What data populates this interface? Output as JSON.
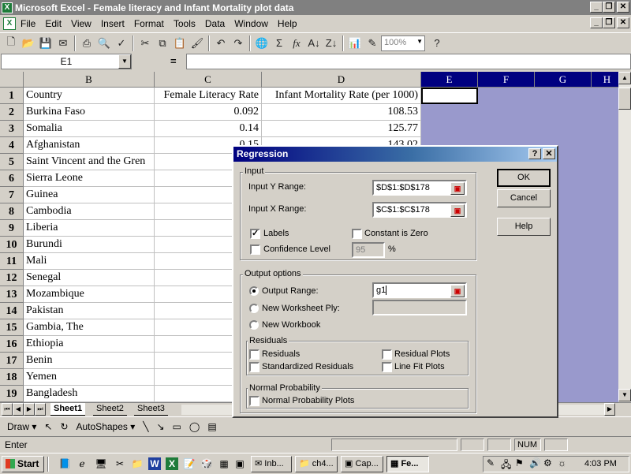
{
  "app": {
    "title": "Microsoft Excel - Female literacy and Infant Mortality plot data",
    "icon_label": "X"
  },
  "menu": [
    "File",
    "Edit",
    "View",
    "Insert",
    "Format",
    "Tools",
    "Data",
    "Window",
    "Help"
  ],
  "toolbar": {
    "zoom": "100%"
  },
  "formula_bar": {
    "name_box": "E1",
    "equals": "=",
    "formula": ""
  },
  "grid": {
    "columns": [
      "B",
      "C",
      "D",
      "E",
      "F",
      "G",
      "H"
    ],
    "selected_column": "E",
    "headers": [
      "Country",
      "Female Literacy Rate",
      "Infant Mortality Rate (per 1000)"
    ],
    "rows": [
      {
        "num": "1"
      },
      {
        "num": "2",
        "country": "Burkina Faso",
        "literacy": "0.092",
        "mortality": "108.53"
      },
      {
        "num": "3",
        "country": "Somalia",
        "literacy": "0.14",
        "mortality": "125.77"
      },
      {
        "num": "4",
        "country": "Afghanistan",
        "literacy": "0.15",
        "mortality": "143.02"
      },
      {
        "num": "5",
        "country": "Saint Vincent and the Gren",
        "literacy": "",
        "mortality": ""
      },
      {
        "num": "6",
        "country": "Sierra Leone"
      },
      {
        "num": "7",
        "country": "Guinea"
      },
      {
        "num": "8",
        "country": "Cambodia"
      },
      {
        "num": "9",
        "country": "Liberia"
      },
      {
        "num": "10",
        "country": "Burundi"
      },
      {
        "num": "11",
        "country": "Mali"
      },
      {
        "num": "12",
        "country": "Senegal"
      },
      {
        "num": "13",
        "country": "Mozambique"
      },
      {
        "num": "14",
        "country": "Pakistan"
      },
      {
        "num": "15",
        "country": "Gambia, The"
      },
      {
        "num": "16",
        "country": "Ethiopia"
      },
      {
        "num": "17",
        "country": "Benin"
      },
      {
        "num": "18",
        "country": "Yemen"
      },
      {
        "num": "19",
        "country": "Bangladesh"
      }
    ]
  },
  "sheets": [
    "Sheet1",
    "Sheet2",
    "Sheet3"
  ],
  "active_sheet": "Sheet1",
  "drawing": {
    "draw": "Draw",
    "autoshapes": "AutoShapes"
  },
  "status": {
    "mode": "Enter",
    "num": "NUM"
  },
  "taskbar": {
    "start": "Start",
    "tasks": [
      "Inb...",
      "ch4...",
      "Cap...",
      "Fe..."
    ],
    "active_task": "Fe...",
    "clock": "4:03 PM"
  },
  "dialog": {
    "title": "Regression",
    "help_glyph": "?",
    "close_glyph": "✕",
    "input_group": "Input",
    "y_range_label": "Input Y Range:",
    "y_range_value": "$D$1:$D$178",
    "x_range_label": "Input X Range:",
    "x_range_value": "$C$1:$C$178",
    "labels_label": "Labels",
    "labels_checked": true,
    "constant_zero_label": "Constant is Zero",
    "constant_zero_checked": false,
    "confidence_label": "Confidence Level",
    "confidence_checked": false,
    "confidence_value": "95",
    "confidence_unit": "%",
    "output_group": "Output options",
    "output_range_label": "Output Range:",
    "output_range_value": "g1",
    "output_range_selected": true,
    "new_ply_label": "New Worksheet Ply:",
    "new_workbook_label": "New Workbook",
    "residuals_group": "Residuals",
    "residuals_label": "Residuals",
    "std_residuals_label": "Standardized Residuals",
    "residual_plots_label": "Residual Plots",
    "line_fit_label": "Line Fit Plots",
    "normal_group": "Normal Probability",
    "normal_plots_label": "Normal Probability Plots",
    "ok": "OK",
    "cancel": "Cancel",
    "help": "Help"
  },
  "colors": {
    "title_bar_inactive": "#808080",
    "dialog_title_start": "#000080",
    "selection_fill": "#9999cc",
    "selected_header": "#000080"
  }
}
